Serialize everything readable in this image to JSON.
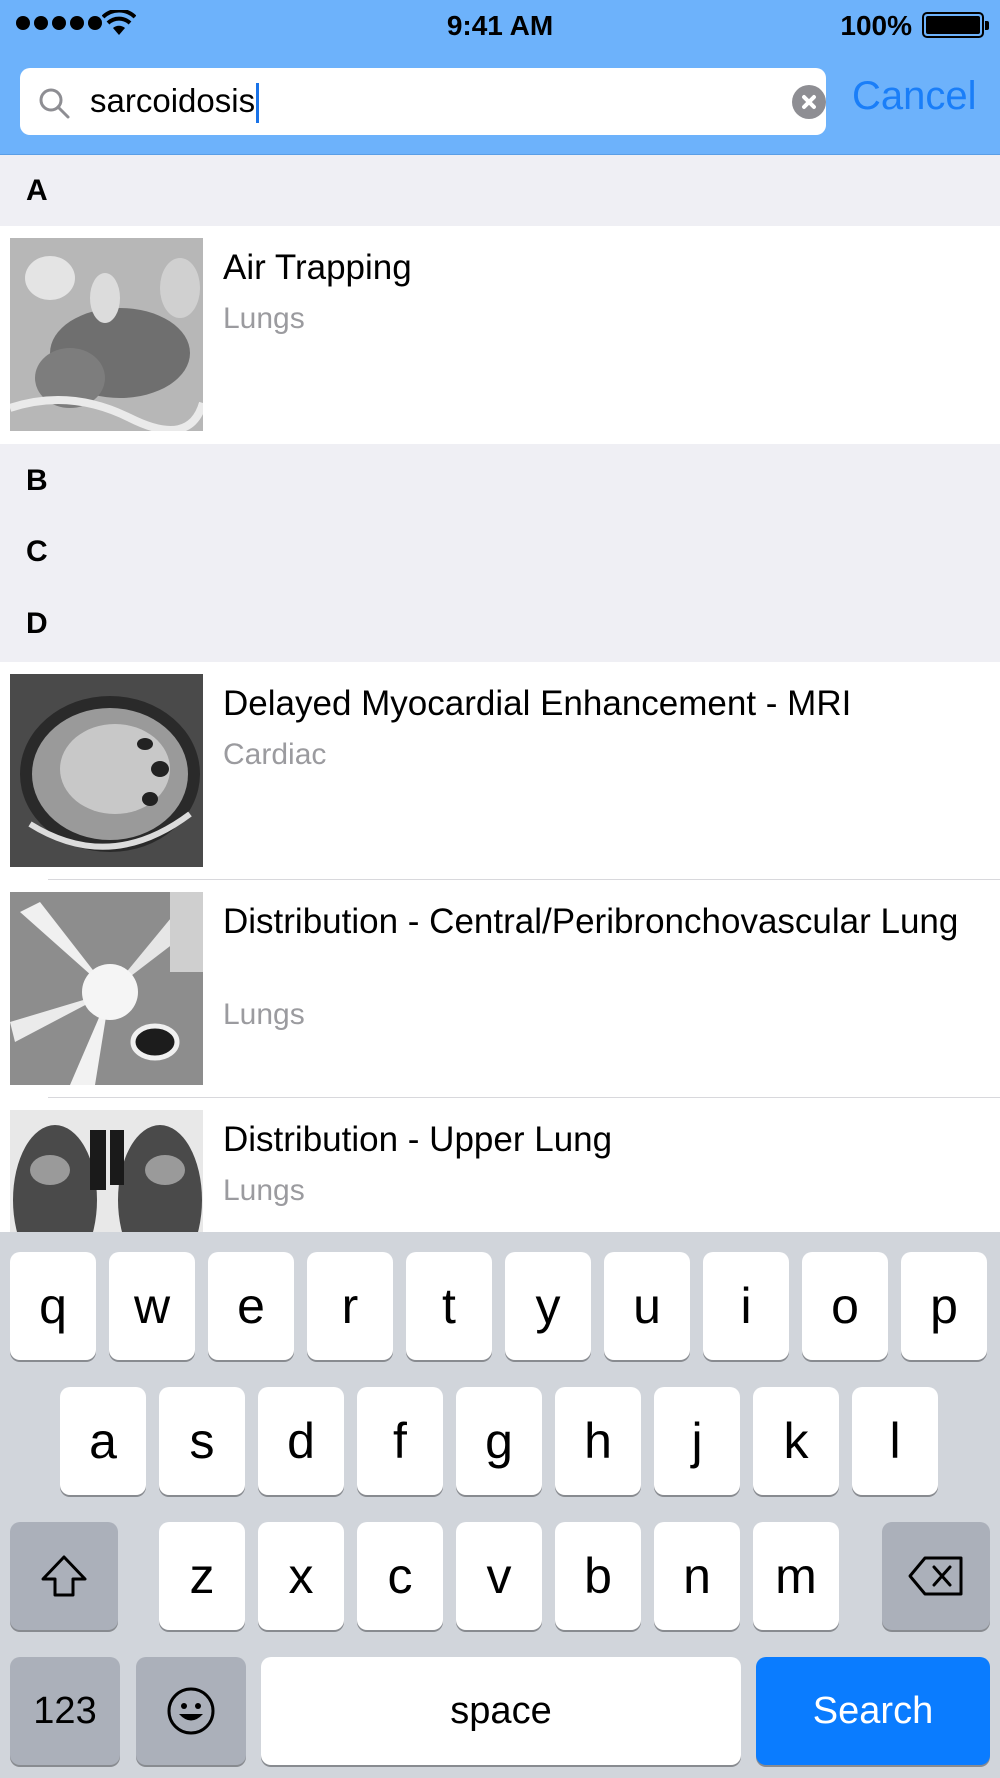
{
  "status_bar": {
    "time": "9:41 AM",
    "battery": "100%"
  },
  "search": {
    "query": "sarcoidosis",
    "cancel_label": "Cancel"
  },
  "sections": [
    {
      "letter": "A"
    },
    {
      "letter": "B"
    },
    {
      "letter": "C"
    },
    {
      "letter": "D"
    }
  ],
  "results": [
    {
      "title": "Air Trapping",
      "category": "Lungs",
      "thumbnail": "ct-lung-image"
    },
    {
      "title": "Delayed Myocardial Enhancement - MRI",
      "category": "Cardiac",
      "thumbnail": "cardiac-mri-image"
    },
    {
      "title": "Distribution - Central/Peribronchovascular Lung",
      "category": "Lungs",
      "thumbnail": "ct-lung-image"
    },
    {
      "title": "Distribution - Upper Lung",
      "category": "Lungs",
      "thumbnail": "ct-coronal-lung-image"
    }
  ],
  "keyboard": {
    "row1": [
      "q",
      "w",
      "e",
      "r",
      "t",
      "y",
      "u",
      "i",
      "o",
      "p"
    ],
    "row2": [
      "a",
      "s",
      "d",
      "f",
      "g",
      "h",
      "j",
      "k",
      "l"
    ],
    "row3": [
      "z",
      "x",
      "c",
      "v",
      "b",
      "n",
      "m"
    ],
    "numbers_label": "123",
    "space_label": "space",
    "search_label": "Search",
    "shift_icon": "shift-icon",
    "delete_icon": "backspace-icon",
    "emoji_icon": "emoji-icon"
  },
  "colors": {
    "header": "#6db2fb",
    "accent": "#1a7ef8",
    "search_key": "#0a7cff",
    "section_bg": "#efeff4",
    "subtitle": "#9b9b9f"
  }
}
